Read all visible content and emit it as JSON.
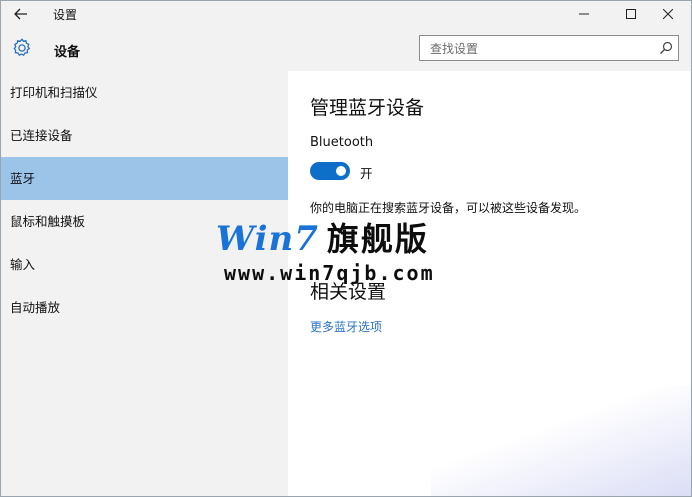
{
  "window": {
    "title": "设置",
    "controls": {
      "minimize": "minimize",
      "maximize": "maximize",
      "close": "close"
    }
  },
  "header": {
    "title": "设备",
    "search_placeholder": "查找设置"
  },
  "sidebar": {
    "items": [
      {
        "label": "打印机和扫描仪",
        "active": false
      },
      {
        "label": "已连接设备",
        "active": false
      },
      {
        "label": "蓝牙",
        "active": true
      },
      {
        "label": "鼠标和触摸板",
        "active": false
      },
      {
        "label": "输入",
        "active": false
      },
      {
        "label": "自动播放",
        "active": false
      }
    ]
  },
  "main": {
    "section_title": "管理蓝牙设备",
    "bluetooth_label": "Bluetooth",
    "toggle_state": "开",
    "toggle_on": true,
    "description": "你的电脑正在搜索蓝牙设备，可以被这些设备发现。",
    "related_title": "相关设置",
    "more_link": "更多蓝牙选项"
  },
  "watermark": {
    "brand": "Win7",
    "brand_cn": "旗舰版",
    "url": "www.win7qjb.com"
  },
  "colors": {
    "accent": "#0e6fc9",
    "selected_bg": "#9cc3e8",
    "link": "#2a73c4",
    "watermark_blue": "#1a73d6"
  }
}
